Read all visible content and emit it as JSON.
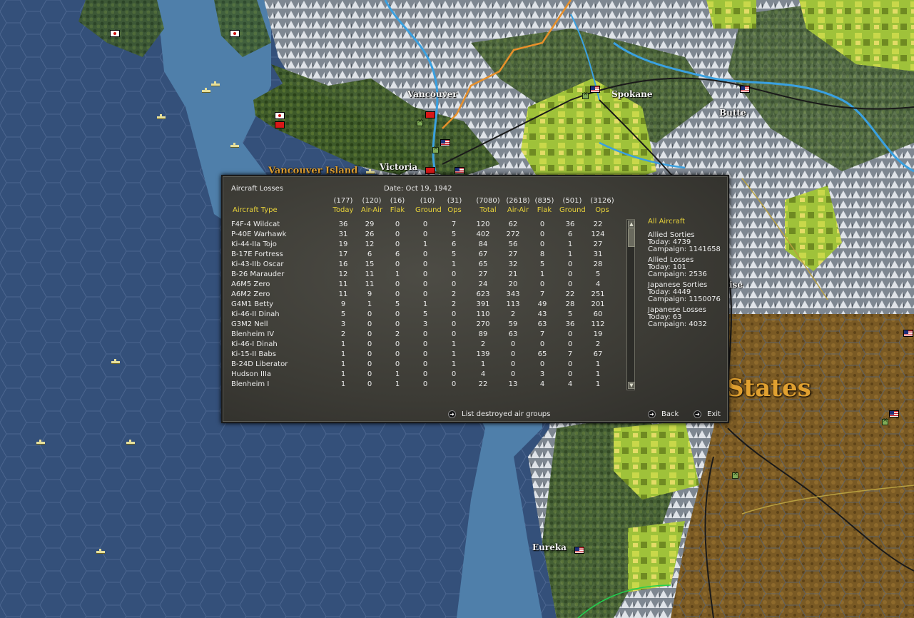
{
  "map": {
    "cities": [
      {
        "name": "Vancouver"
      },
      {
        "name": "Spokane"
      },
      {
        "name": "Butte"
      },
      {
        "name": "Victoria"
      },
      {
        "name": "Eureka"
      },
      {
        "name": "ise"
      }
    ],
    "island_label": "Vancouver Island",
    "country_label": "States"
  },
  "panel": {
    "title": "Aircraft Losses",
    "date": "Date: Oct 19, 1942",
    "col_headers": {
      "type": "Aircraft Type",
      "today": "Today",
      "air_air": "Air-Air",
      "flak": "Flak",
      "ground": "Ground",
      "ops": "Ops",
      "total": "Total",
      "c_air_air": "Air-Air",
      "c_flak": "Flak",
      "c_ground": "Ground",
      "c_ops": "Ops"
    },
    "col_totals": {
      "today": "(177)",
      "air_air": "(120)",
      "flak": "(16)",
      "ground": "(10)",
      "ops": "(31)",
      "total": "(7080)",
      "c_air_air": "(2618)",
      "c_flak": "(835)",
      "c_ground": "(501)",
      "c_ops": "(3126)"
    },
    "rows": [
      [
        "F4F-4 Wildcat",
        "36",
        "29",
        "0",
        "0",
        "7",
        "120",
        "62",
        "0",
        "36",
        "22"
      ],
      [
        "P-40E Warhawk",
        "31",
        "26",
        "0",
        "0",
        "5",
        "402",
        "272",
        "0",
        "6",
        "124"
      ],
      [
        "Ki-44-IIa Tojo",
        "19",
        "12",
        "0",
        "1",
        "6",
        "84",
        "56",
        "0",
        "1",
        "27"
      ],
      [
        "B-17E Fortress",
        "17",
        "6",
        "6",
        "0",
        "5",
        "67",
        "27",
        "8",
        "1",
        "31"
      ],
      [
        "Ki-43-IIb Oscar",
        "16",
        "15",
        "0",
        "0",
        "1",
        "65",
        "32",
        "5",
        "0",
        "28"
      ],
      [
        "B-26 Marauder",
        "12",
        "11",
        "1",
        "0",
        "0",
        "27",
        "21",
        "1",
        "0",
        "5"
      ],
      [
        "A6M5 Zero",
        "11",
        "11",
        "0",
        "0",
        "0",
        "24",
        "20",
        "0",
        "0",
        "4"
      ],
      [
        "A6M2 Zero",
        "11",
        "9",
        "0",
        "0",
        "2",
        "623",
        "343",
        "7",
        "22",
        "251"
      ],
      [
        "G4M1 Betty",
        "9",
        "1",
        "5",
        "1",
        "2",
        "391",
        "113",
        "49",
        "28",
        "201"
      ],
      [
        "Ki-46-II Dinah",
        "5",
        "0",
        "0",
        "5",
        "0",
        "110",
        "2",
        "43",
        "5",
        "60"
      ],
      [
        "G3M2 Nell",
        "3",
        "0",
        "0",
        "3",
        "0",
        "270",
        "59",
        "63",
        "36",
        "112"
      ],
      [
        "Blenheim IV",
        "2",
        "0",
        "2",
        "0",
        "0",
        "89",
        "63",
        "7",
        "0",
        "19"
      ],
      [
        "Ki-46-I Dinah",
        "1",
        "0",
        "0",
        "0",
        "1",
        "2",
        "0",
        "0",
        "0",
        "2"
      ],
      [
        "Ki-15-II Babs",
        "1",
        "0",
        "0",
        "0",
        "1",
        "139",
        "0",
        "65",
        "7",
        "67"
      ],
      [
        "B-24D Liberator",
        "1",
        "0",
        "0",
        "0",
        "1",
        "1",
        "0",
        "0",
        "0",
        "1"
      ],
      [
        "Hudson IIIa",
        "1",
        "0",
        "1",
        "0",
        "0",
        "4",
        "0",
        "3",
        "0",
        "1"
      ],
      [
        "Blenheim I",
        "1",
        "0",
        "1",
        "0",
        "0",
        "22",
        "13",
        "4",
        "4",
        "1"
      ]
    ],
    "sidebar": {
      "filter": "All Aircraft",
      "allied_sorties": {
        "label": "Allied Sorties",
        "today": "Today:  4739",
        "campaign": "Campaign: 1141658"
      },
      "allied_losses": {
        "label": "Allied Losses",
        "today": "Today:   101",
        "campaign": "Campaign: 2536"
      },
      "japanese_sorties": {
        "label": "Japanese Sorties",
        "today": "Today:  4449",
        "campaign": "Campaign: 1150076"
      },
      "japanese_losses": {
        "label": "Japanese Losses",
        "today": "Today:   63",
        "campaign": "Campaign: 4032"
      }
    },
    "buttons": {
      "list": "List destroyed air groups",
      "back": "Back",
      "exit": "Exit"
    },
    "colors": {
      "accent": "#e7d23a",
      "text": "#ececec",
      "panel": "#403f39"
    }
  }
}
